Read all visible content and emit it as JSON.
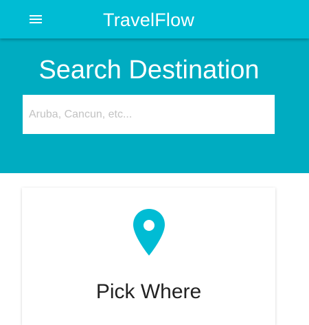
{
  "header": {
    "title": "TravelFlow",
    "menu_icon": "hamburger-menu-icon",
    "background_color": "#00bcd4"
  },
  "hero": {
    "title": "Search Destination",
    "background_color": "#00acc1",
    "search": {
      "value": "",
      "placeholder": "Aruba, Cancun, etc..."
    }
  },
  "card": {
    "icon": "map-pin-icon",
    "icon_color": "#00bcd4",
    "title": "Pick Where"
  }
}
